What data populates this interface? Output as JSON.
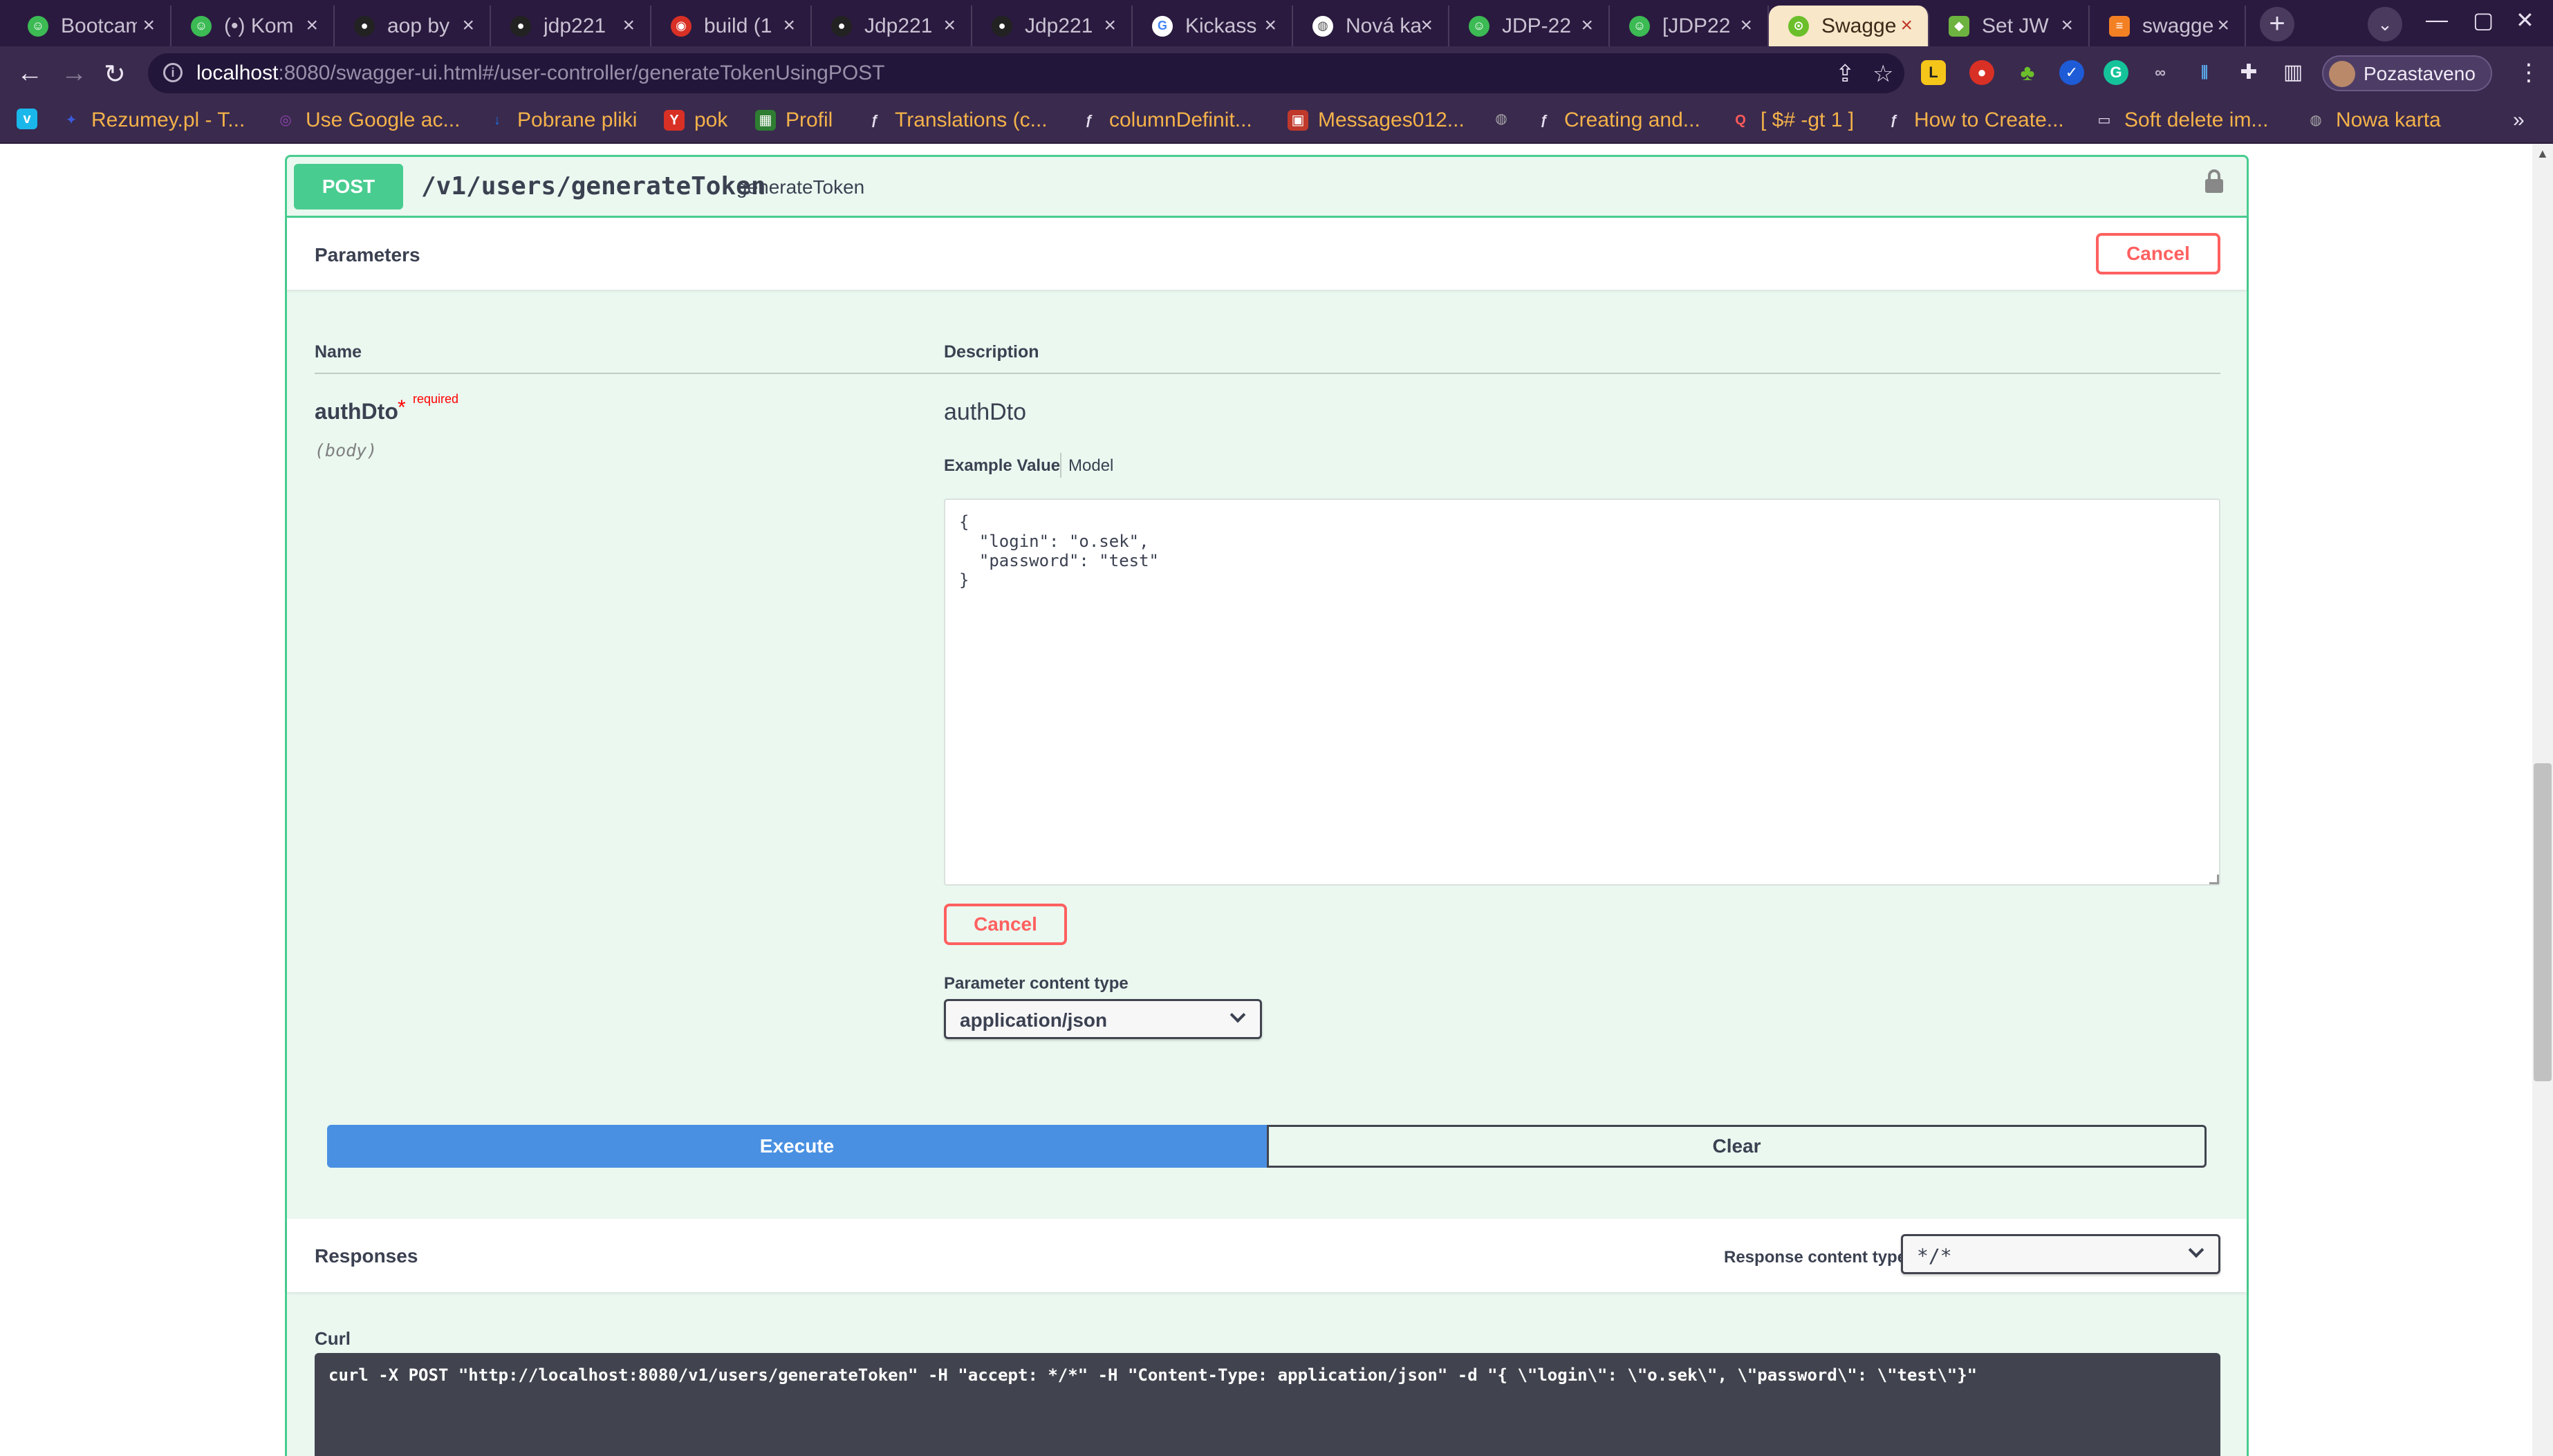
{
  "browser": {
    "tabs": [
      {
        "label": "Bootcamp",
        "color": "#3cba54",
        "glyph": "☺"
      },
      {
        "label": "(•) Kom",
        "color": "#3cba54",
        "glyph": "☺"
      },
      {
        "label": "aop by",
        "color": "#222222",
        "glyph": "●"
      },
      {
        "label": "jdp221",
        "color": "#222222",
        "glyph": "●"
      },
      {
        "label": "build (1",
        "color": "#d93025",
        "glyph": "◉"
      },
      {
        "label": "Jdp221",
        "color": "#222222",
        "glyph": "●"
      },
      {
        "label": "Jdp221",
        "color": "#222222",
        "glyph": "●"
      },
      {
        "label": "Kickass",
        "color": "#ffffff",
        "glyph": "G"
      },
      {
        "label": "Nová ka",
        "color": "#ffffff",
        "glyph": "◍"
      },
      {
        "label": "JDP-22",
        "color": "#3cba54",
        "glyph": "☺"
      },
      {
        "label": "[JDP22",
        "color": "#3cba54",
        "glyph": "☺"
      },
      {
        "label": "Swagger",
        "color": "#6bbf2a",
        "glyph": "⊙",
        "active": true
      },
      {
        "label": "Set JW",
        "color": "#6db33f",
        "glyph": "◆"
      },
      {
        "label": "swagge",
        "color": "#f48024",
        "glyph": "≡"
      }
    ],
    "url_host": "localhost",
    "url_rest": ":8080/swagger-ui.html#/user-controller/generateTokenUsingPOST",
    "profile_label": "Pozastaveno",
    "bookmarks": [
      {
        "label": "Rezumey.pl - T...",
        "color": "#3b5bdb",
        "glyph": "✦"
      },
      {
        "label": "Use Google ac...",
        "color": "#8e44ad",
        "glyph": "◎"
      },
      {
        "label": "Pobrane pliki",
        "color": "#1a73e8",
        "glyph": "↓"
      },
      {
        "label": "pok",
        "color": "#d93025",
        "glyph": "Y"
      },
      {
        "label": "Profil",
        "color": "#2e7d32",
        "glyph": "▦"
      },
      {
        "label": "Translations (c...",
        "color": "#333333",
        "glyph": "ƒ"
      },
      {
        "label": "columnDefinit...",
        "color": "#333333",
        "glyph": "ƒ"
      },
      {
        "label": "Messages012...",
        "color": "#c0392b",
        "glyph": "▣"
      },
      {
        "label": "",
        "color": "#555555",
        "glyph": "◍"
      },
      {
        "label": "Creating and...",
        "color": "#333333",
        "glyph": "ƒ"
      },
      {
        "label": "[ $# -gt 1 ]",
        "color": "#d93025",
        "glyph": "Q"
      },
      {
        "label": "How to Create...",
        "color": "#333333",
        "glyph": "ƒ"
      },
      {
        "label": "Soft delete im...",
        "color": "#555555",
        "glyph": "▭"
      },
      {
        "label": "Nowa karta",
        "color": "#555555",
        "glyph": "◍"
      }
    ]
  },
  "operation": {
    "method": "POST",
    "path": "/v1/users/generateToken",
    "operation_id": "generateToken"
  },
  "parameters": {
    "title": "Parameters",
    "cancel_label": "Cancel",
    "col_name": "Name",
    "col_description": "Description",
    "param": {
      "name": "authDto",
      "star": "*",
      "required_label": "required",
      "in": "(body)",
      "description": "authDto"
    },
    "tab_example": "Example Value",
    "tab_model": "Model",
    "body_value": "{\n  \"login\": \"o.sek\",\n  \"password\": \"test\"\n}",
    "cancel_label_2": "Cancel",
    "content_type_label": "Parameter content type",
    "content_type_value": "application/json"
  },
  "actions": {
    "execute_label": "Execute",
    "clear_label": "Clear"
  },
  "responses": {
    "title": "Responses",
    "content_type_label": "Response content type",
    "content_type_value": "*/*",
    "curl_label": "Curl",
    "curl_command": "curl -X POST \"http://localhost:8080/v1/users/generateToken\" -H \"accept: */*\" -H \"Content-Type: application/json\" -d \"{ \\\"login\\\": \\\"o.sek\\\", \\\"password\\\": \\\"test\\\"}\""
  },
  "colors": {
    "post": "#49cc90",
    "post_bg": "#eaf8f0",
    "execute": "#4990e2",
    "cancel": "#ff6060",
    "curl_bg": "#41444e"
  }
}
